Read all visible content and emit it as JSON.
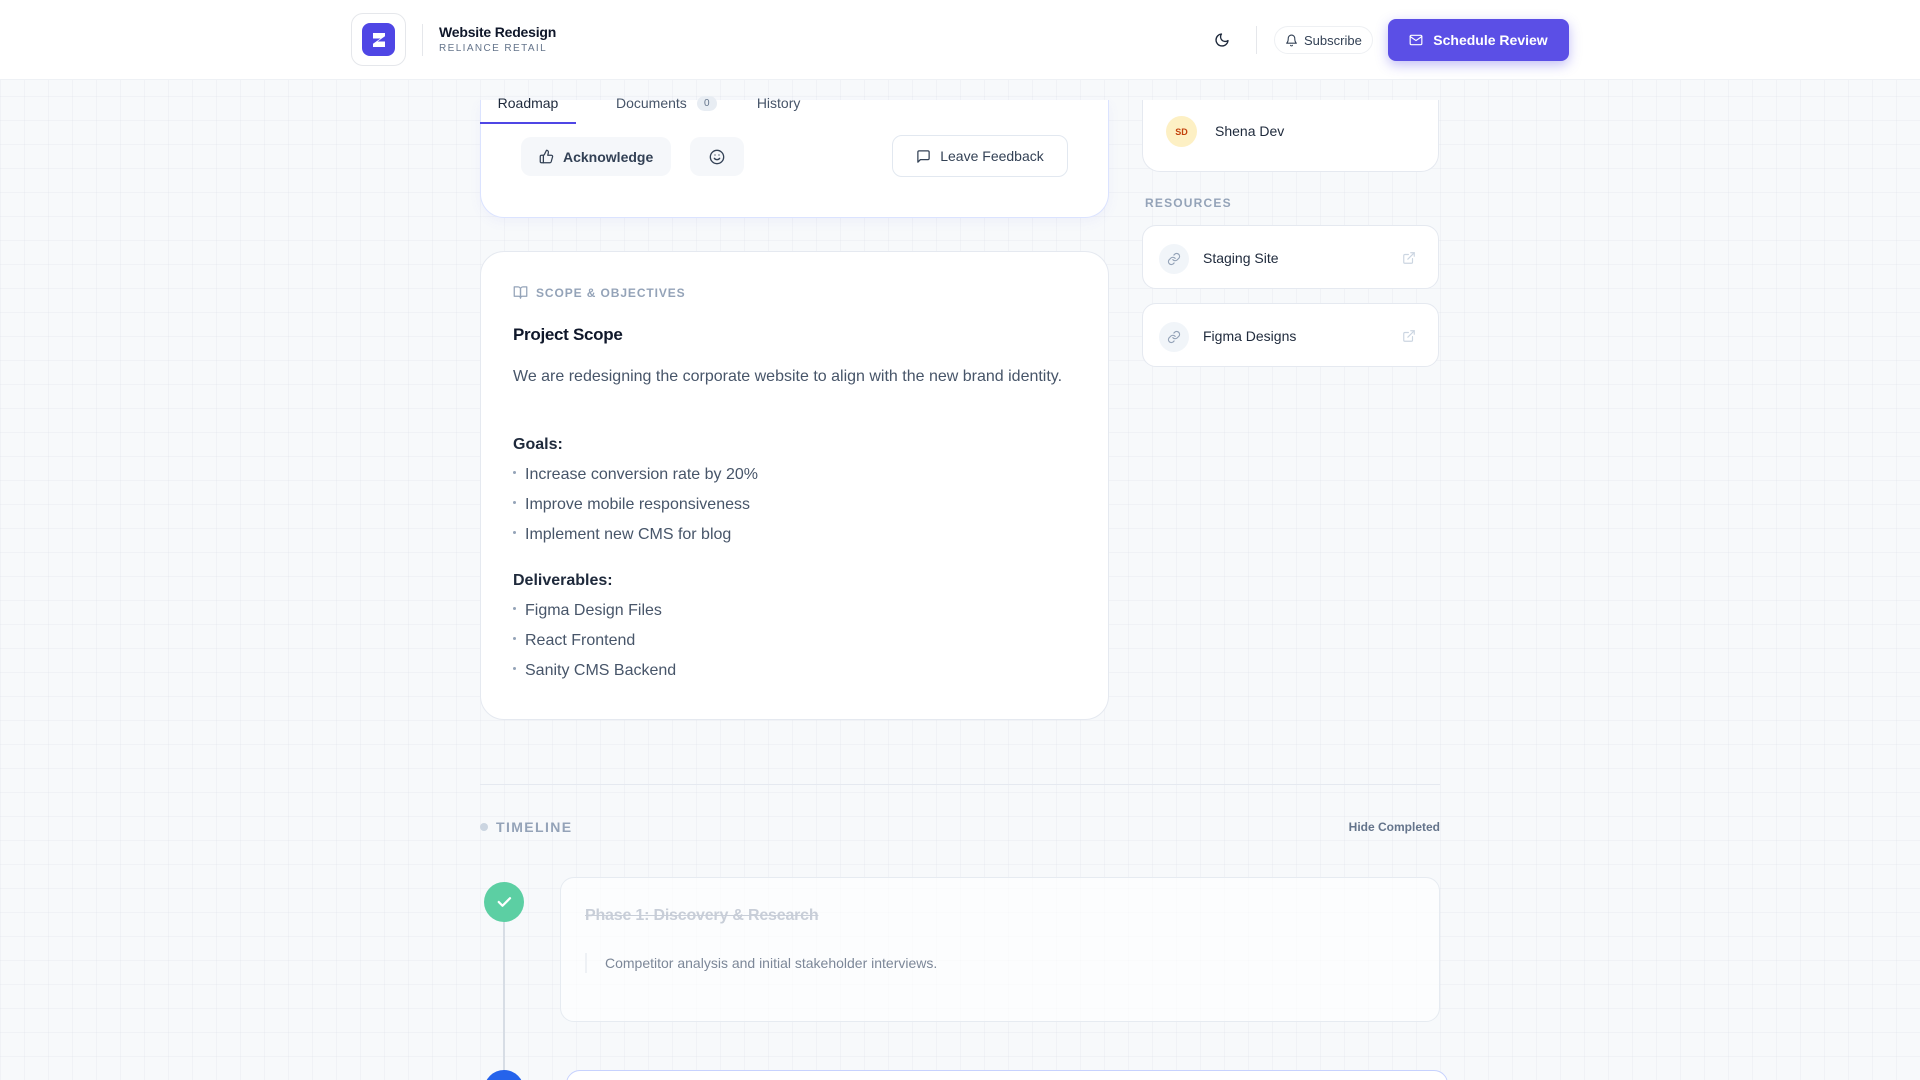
{
  "header": {
    "project_title": "Website Redesign",
    "client_name": "RELIANCE RETAIL",
    "subscribe_label": "Subscribe",
    "schedule_label": "Schedule Review"
  },
  "tabs": [
    {
      "label": "Roadmap",
      "active": true
    },
    {
      "label": "Documents",
      "badge": "0",
      "active": false
    },
    {
      "label": "History",
      "active": false
    }
  ],
  "feedback": {
    "acknowledge_label": "Acknowledge",
    "leave_feedback_label": "Leave Feedback"
  },
  "scope": {
    "section_label": "SCOPE & OBJECTIVES",
    "title": "Project Scope",
    "intro": "We are redesigning the corporate website to align with the new brand identity.",
    "goals_title": "Goals:",
    "goals": [
      "Increase conversion rate by 20%",
      "Improve mobile responsiveness",
      "Implement new CMS for blog"
    ],
    "deliverables_title": "Deliverables:",
    "deliverables": [
      "Figma Design Files",
      "React Frontend",
      "Sanity CMS Backend"
    ]
  },
  "team": {
    "member_initials": "SD",
    "member_name": "Shena Dev"
  },
  "resources": {
    "label": "RESOURCES",
    "items": [
      {
        "label": "Staging Site"
      },
      {
        "label": "Figma Designs"
      }
    ]
  },
  "timeline": {
    "label": "TIMELINE",
    "hide_completed_label": "Hide Completed",
    "phases": [
      {
        "title": "Phase 1: Discovery & Research",
        "description": "Competitor analysis and initial stakeholder interviews.",
        "status": "completed"
      }
    ]
  },
  "colors": {
    "accent": "#4f46e5",
    "success": "#5ccfa3",
    "active_phase": "#2563eb"
  },
  "icons": {
    "logo": "brand-logo-icon",
    "theme": "moon-icon",
    "subscribe": "bell-icon",
    "schedule": "mail-icon",
    "acknowledge": "thumbs-up-icon",
    "reaction": "smile-icon",
    "feedback": "message-square-icon",
    "scope": "book-open-icon",
    "resource": "link-icon",
    "external": "external-link-icon",
    "completed": "check-icon"
  }
}
